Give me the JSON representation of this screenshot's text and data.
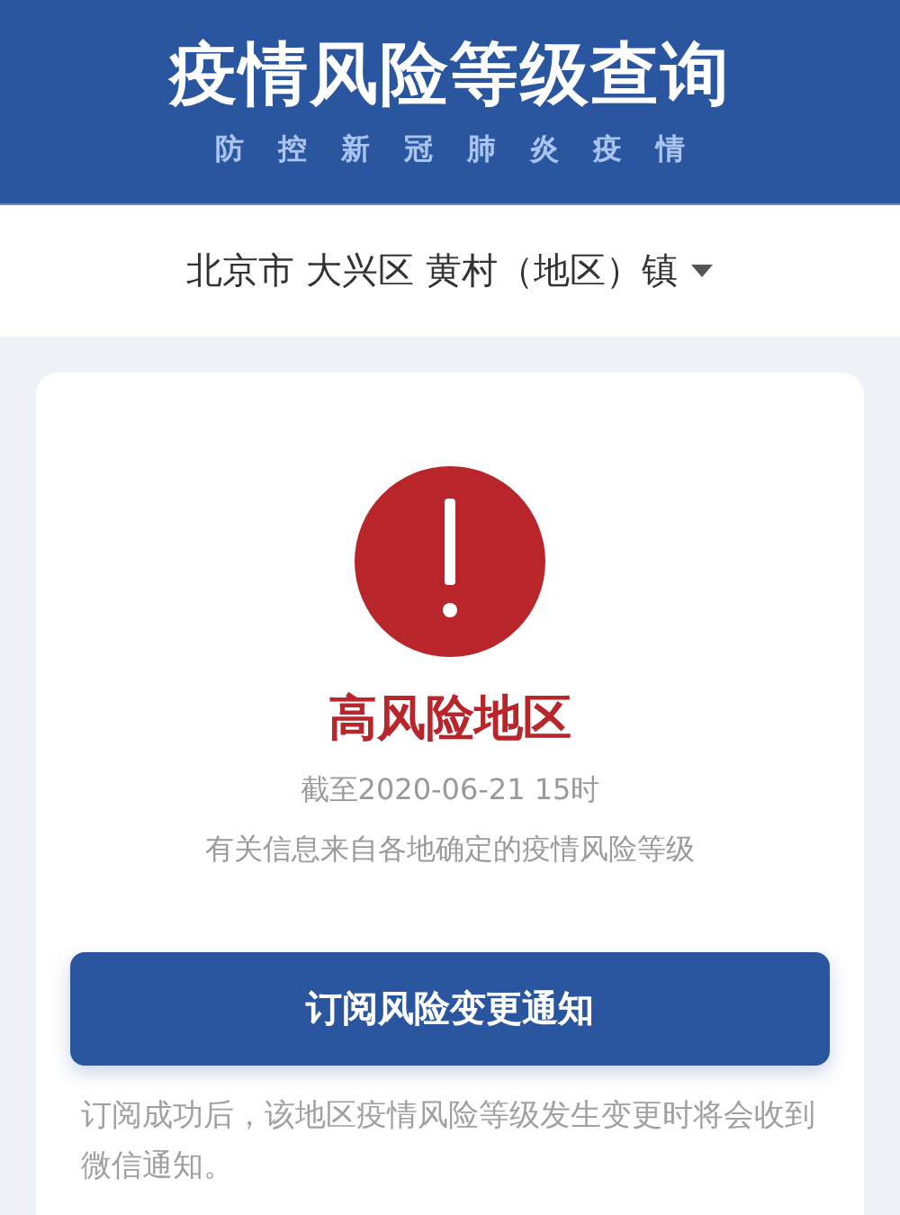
{
  "header": {
    "title": "疫情风险等级查询",
    "subtitle": [
      "防",
      "控",
      "新",
      "冠",
      "肺",
      "炎",
      "疫",
      "情"
    ]
  },
  "location": {
    "value": "北京市 大兴区 黄村（地区）镇"
  },
  "result": {
    "kind": "high",
    "level": "高风险地区",
    "as_of": "截至2020-06-21 15时",
    "source": "有关信息来自各地确定的疫情风险等级"
  },
  "subscribe_button": "订阅风险变更通知",
  "note": "订阅成功后，该地区疫情风险等级发生变更时将会收到微信通知。"
}
